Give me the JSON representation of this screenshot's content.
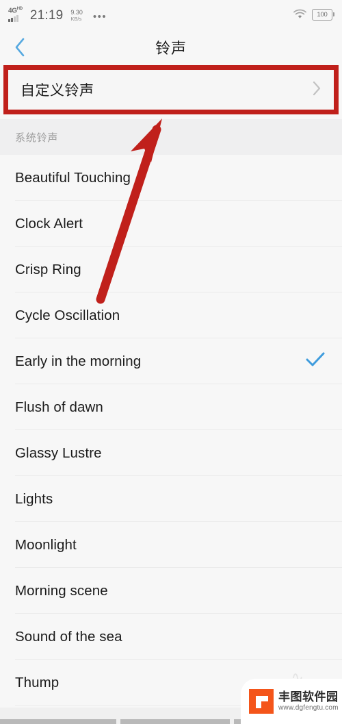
{
  "status_bar": {
    "network": "4G",
    "network_sup": "HD",
    "time": "21:19",
    "net_speed_value": "9.30",
    "net_speed_unit": "KB/s",
    "more_dots": "•••",
    "wifi_icon": "wifi-icon",
    "battery_level": "100"
  },
  "header": {
    "back_icon": "chevron-left-icon",
    "title": "铃声",
    "back_color": "#57a9e0"
  },
  "custom_ringtone": {
    "label": "自定义铃声",
    "chevron_icon": "chevron-right-icon",
    "highlight_color": "#c0201b"
  },
  "section": {
    "title": "系统铃声"
  },
  "ringtones": [
    {
      "name": "Beautiful Touching",
      "selected": false
    },
    {
      "name": "Clock Alert",
      "selected": false
    },
    {
      "name": "Crisp Ring",
      "selected": false
    },
    {
      "name": "Cycle Oscillation",
      "selected": false
    },
    {
      "name": "Early in the morning",
      "selected": true
    },
    {
      "name": "Flush of dawn",
      "selected": false
    },
    {
      "name": "Glassy Lustre",
      "selected": false
    },
    {
      "name": "Lights",
      "selected": false
    },
    {
      "name": "Moonlight",
      "selected": false
    },
    {
      "name": "Morning scene",
      "selected": false
    },
    {
      "name": "Sound of the sea",
      "selected": false
    },
    {
      "name": "Thump",
      "selected": false
    }
  ],
  "selection": {
    "check_icon": "check-icon",
    "check_color": "#3f9cdd"
  },
  "annotation": {
    "arrow_icon": "arrow-up-right-icon",
    "color": "#c0201b"
  },
  "watermark": {
    "logo_icon": "fengtu-logo-icon",
    "brand": "丰图软件园",
    "url": "www.dgfengtu.com",
    "brand_color": "#f4551a"
  },
  "bottom_nav": {
    "segments": [
      "nav-segment-1",
      "nav-segment-2",
      "nav-segment-3"
    ]
  }
}
